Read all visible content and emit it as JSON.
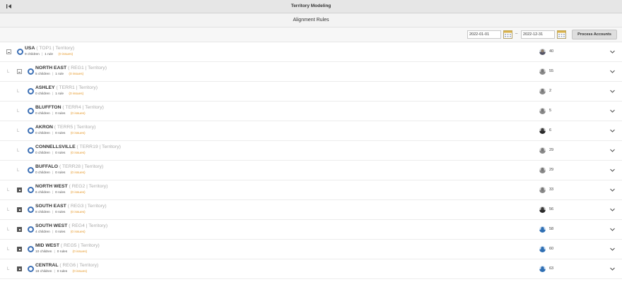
{
  "header": {
    "title": "Territory Modeling"
  },
  "subheader": {
    "title": "Alignment Rules"
  },
  "toolbar": {
    "start_date": "2022-01-01",
    "end_date": "2022-12-31",
    "range_separator": "–",
    "process_label": "Process Accounts"
  },
  "colors": {
    "accent": "#3b6fb5",
    "issues": "#e69a2c"
  },
  "rows": [
    {
      "level": 0,
      "toggle": "minus",
      "name": "USA",
      "meta": " ( TOP1 | Territory)",
      "children": "9 children",
      "rules": "1 rule",
      "issues": "(0 issues)",
      "avatar": "photo",
      "count": "40"
    },
    {
      "level": 1,
      "toggle": "minus",
      "name": "NORTH EAST",
      "meta": " ( REG1 | Territory)",
      "children": "5 children",
      "rules": "1 rule",
      "issues": "(0 issues)",
      "avatar": "grey",
      "count": "55"
    },
    {
      "level": 2,
      "toggle": "none",
      "name": "ASHLEY",
      "meta": " ( TERR1 | Territory)",
      "children": "0 children",
      "rules": "1 rule",
      "issues": "(0 issues)",
      "avatar": "grey",
      "count": "2"
    },
    {
      "level": 2,
      "toggle": "none",
      "name": "BLUFFTON",
      "meta": " ( TERR4 | Territory)",
      "children": "0 children",
      "rules": "0 rules",
      "issues": "(0 issues)",
      "avatar": "grey",
      "count": "5"
    },
    {
      "level": 2,
      "toggle": "none",
      "name": "AKRON",
      "meta": " ( TERR5 | Territory)",
      "children": "0 children",
      "rules": "0 rules",
      "issues": "(0 issues)",
      "avatar": "dark",
      "count": "6"
    },
    {
      "level": 2,
      "toggle": "none",
      "name": "CONNELLSVILLE",
      "meta": " ( TERR19 | Territory)",
      "children": "0 children",
      "rules": "0 rules",
      "issues": "(0 issues)",
      "avatar": "grey",
      "count": "29"
    },
    {
      "level": 2,
      "toggle": "none",
      "name": "BUFFALO",
      "meta": " ( TERR28 | Territory)",
      "children": "0 children",
      "rules": "0 rules",
      "issues": "(0 issues)",
      "avatar": "grey",
      "count": "29"
    },
    {
      "level": 1,
      "toggle": "plus",
      "name": "NORTH WEST",
      "meta": " ( REG2 | Territory)",
      "children": "6 children",
      "rules": "0 rules",
      "issues": "(0 issues)",
      "avatar": "grey",
      "count": "33"
    },
    {
      "level": 1,
      "toggle": "plus",
      "name": "SOUTH EAST",
      "meta": " ( REG3 | Territory)",
      "children": "8 children",
      "rules": "0 rules",
      "issues": "(0 issues)",
      "avatar": "dark",
      "count": "56"
    },
    {
      "level": 1,
      "toggle": "plus",
      "name": "SOUTH WEST",
      "meta": " ( REG4 | Territory)",
      "children": "4 children",
      "rules": "0 rules",
      "issues": "(0 issues)",
      "avatar": "blue",
      "count": "58"
    },
    {
      "level": 1,
      "toggle": "plus",
      "name": "MID WEST",
      "meta": " ( REG5 | Territory)",
      "children": "10 children",
      "rules": "0 rules",
      "issues": "(0 issues)",
      "avatar": "blue",
      "count": "60"
    },
    {
      "level": 1,
      "toggle": "plus",
      "name": "CENTRAL",
      "meta": " ( REG6 | Territory)",
      "children": "18 children",
      "rules": "0 rules",
      "issues": "(0 issues)",
      "avatar": "blue",
      "count": "63"
    }
  ]
}
